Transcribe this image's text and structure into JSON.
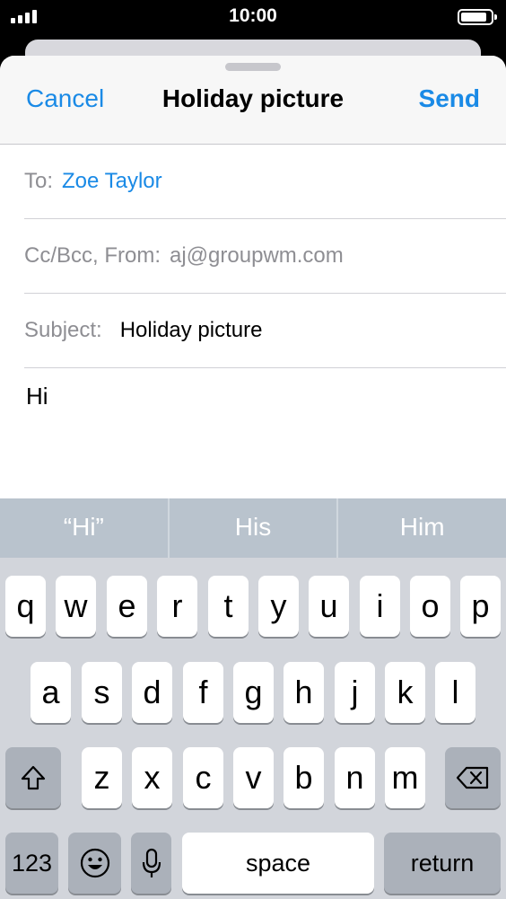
{
  "status_bar": {
    "time": "10:00"
  },
  "compose": {
    "cancel_label": "Cancel",
    "title": "Holiday picture",
    "send_label": "Send",
    "to_label": "To:",
    "to_value": "Zoe Taylor",
    "cc_label": "Cc/Bcc, From:",
    "cc_value": "aj@groupwm.com",
    "subject_label": "Subject:",
    "subject_value": "Holiday picture",
    "body": "Hi"
  },
  "predictions": [
    "“Hi”",
    "His",
    "Him"
  ],
  "keyboard": {
    "row1": [
      "q",
      "w",
      "e",
      "r",
      "t",
      "y",
      "u",
      "i",
      "o",
      "p"
    ],
    "row2": [
      "a",
      "s",
      "d",
      "f",
      "g",
      "h",
      "j",
      "k",
      "l"
    ],
    "row3": [
      "z",
      "x",
      "c",
      "v",
      "b",
      "n",
      "m"
    ],
    "numbers_label": "123",
    "space_label": "space",
    "return_label": "return"
  }
}
